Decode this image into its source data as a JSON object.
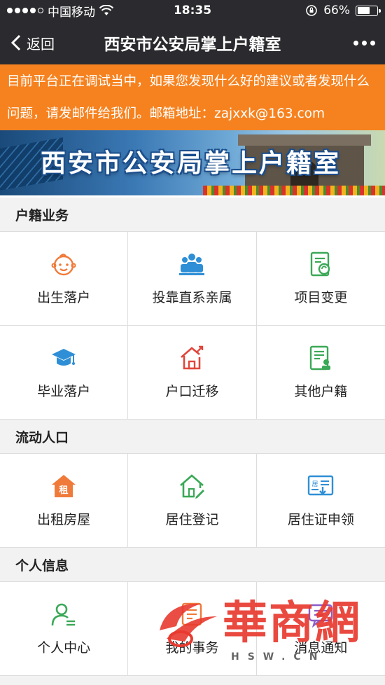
{
  "status_bar": {
    "carrier": "中国移动",
    "time": "18:35",
    "battery_pct": "66%",
    "battery_level": 0.66
  },
  "nav": {
    "back_label": "返回",
    "title": "西安市公安局掌上户籍室"
  },
  "notice": {
    "text": "目前平台正在调试当中，如果您发现什么好的建议或者发现什么问题，请发邮件给我们。邮箱地址：zajxxk@163.com"
  },
  "banner": {
    "title": "西安市公安局掌上户籍室"
  },
  "sections": [
    {
      "title": "户籍业务",
      "items": [
        {
          "label": "出生落户",
          "icon": "baby-face-icon"
        },
        {
          "label": "投靠直系亲属",
          "icon": "family-icon"
        },
        {
          "label": "项目变更",
          "icon": "document-refresh-icon"
        },
        {
          "label": "毕业落户",
          "icon": "graduation-cap-icon"
        },
        {
          "label": "户口迁移",
          "icon": "house-arrow-icon"
        },
        {
          "label": "其他户籍",
          "icon": "document-person-icon"
        }
      ]
    },
    {
      "title": "流动人口",
      "items": [
        {
          "label": "出租房屋",
          "icon": "rent-house-icon"
        },
        {
          "label": "居住登记",
          "icon": "house-pen-icon"
        },
        {
          "label": "居住证申领",
          "icon": "residence-card-icon"
        }
      ]
    },
    {
      "title": "个人信息",
      "items": [
        {
          "label": "个人中心",
          "icon": "user-icon"
        },
        {
          "label": "我的事务",
          "icon": "tasks-icon"
        },
        {
          "label": "消息通知",
          "icon": "message-icon"
        }
      ]
    }
  ],
  "watermark": {
    "text": "華商網",
    "sub": "HSW.CN"
  },
  "colors": {
    "bar": "#2b2b2f",
    "notice": "#f6821f",
    "orange": "#f07a3a",
    "blue": "#2f8fd6",
    "green": "#3aa856",
    "red": "#e0463c"
  }
}
